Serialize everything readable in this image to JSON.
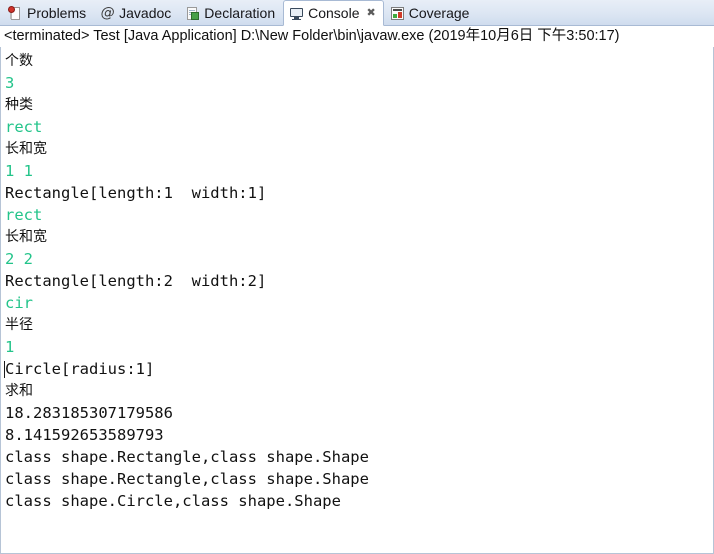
{
  "window": {
    "title": "Console"
  },
  "tabbar": {
    "tabs": [
      {
        "label": "Problems",
        "icon": "problems-icon",
        "active": false,
        "closable": false
      },
      {
        "label": "Javadoc",
        "icon": "javadoc-icon",
        "active": false,
        "closable": false
      },
      {
        "label": "Declaration",
        "icon": "declaration-icon",
        "active": false,
        "closable": false
      },
      {
        "label": "Console",
        "icon": "console-icon",
        "active": true,
        "closable": true,
        "close_glyph": "✖"
      },
      {
        "label": "Coverage",
        "icon": "coverage-icon",
        "active": false,
        "closable": false
      }
    ]
  },
  "process": {
    "line": "<terminated> Test [Java Application] D:\\New Folder\\bin\\javaw.exe (2019年10月6日 下午3:50:17)"
  },
  "console": {
    "lines": [
      {
        "text": "个数",
        "kind": "cn"
      },
      {
        "text": "3",
        "kind": "input"
      },
      {
        "text": "种类",
        "kind": "cn"
      },
      {
        "text": "rect",
        "kind": "input"
      },
      {
        "text": "长和宽",
        "kind": "cn"
      },
      {
        "text": "1 1",
        "kind": "input"
      },
      {
        "text": "Rectangle[length:1  width:1]",
        "kind": "mono"
      },
      {
        "text": "rect",
        "kind": "input"
      },
      {
        "text": "长和宽",
        "kind": "cn"
      },
      {
        "text": "2 2",
        "kind": "input"
      },
      {
        "text": "Rectangle[length:2  width:2]",
        "kind": "mono"
      },
      {
        "text": "cir",
        "kind": "input"
      },
      {
        "text": "半径",
        "kind": "cn"
      },
      {
        "text": "1",
        "kind": "input"
      },
      {
        "text": "Circle[radius:1]",
        "kind": "mono",
        "caret": true
      },
      {
        "text": "求和",
        "kind": "cn"
      },
      {
        "text": "18.283185307179586",
        "kind": "mono"
      },
      {
        "text": "8.141592653589793",
        "kind": "mono"
      },
      {
        "text": "class shape.Rectangle,class shape.Shape",
        "kind": "mono"
      },
      {
        "text": "class shape.Rectangle,class shape.Shape",
        "kind": "mono"
      },
      {
        "text": "class shape.Circle,class shape.Shape",
        "kind": "mono"
      }
    ]
  },
  "colors": {
    "input_green": "#23c48a",
    "output_black": "#111111",
    "tab_active_bg": "#ffffff",
    "tabbar_bg": "#dce6f3",
    "border": "#a8bad4"
  }
}
